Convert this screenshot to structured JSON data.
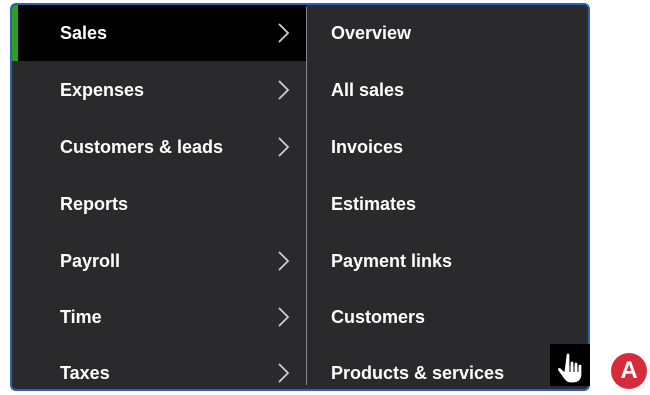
{
  "nav": {
    "items": [
      {
        "label": "Sales",
        "has_submenu": true,
        "active": true
      },
      {
        "label": "Expenses",
        "has_submenu": true,
        "active": false
      },
      {
        "label": "Customers & leads",
        "has_submenu": true,
        "active": false
      },
      {
        "label": "Reports",
        "has_submenu": false,
        "active": false
      },
      {
        "label": "Payroll",
        "has_submenu": true,
        "active": false
      },
      {
        "label": "Time",
        "has_submenu": true,
        "active": false
      },
      {
        "label": "Taxes",
        "has_submenu": true,
        "active": false
      }
    ]
  },
  "submenu": {
    "items": [
      {
        "label": "Overview"
      },
      {
        "label": "All sales"
      },
      {
        "label": "Invoices"
      },
      {
        "label": "Estimates"
      },
      {
        "label": "Payment links"
      },
      {
        "label": "Customers"
      },
      {
        "label": "Products & services"
      }
    ]
  },
  "callout": {
    "label": "A"
  },
  "colors": {
    "panel_bg": "#2a2a2c",
    "active_bg": "#000000",
    "active_indicator": "#2ca01c",
    "panel_border": "#2d5fb4",
    "text": "#ffffff",
    "callout": "#d52b3a"
  },
  "icons": {
    "submenu_arrow": "chevron-right-icon",
    "pointer": "hand-pointer-icon"
  }
}
